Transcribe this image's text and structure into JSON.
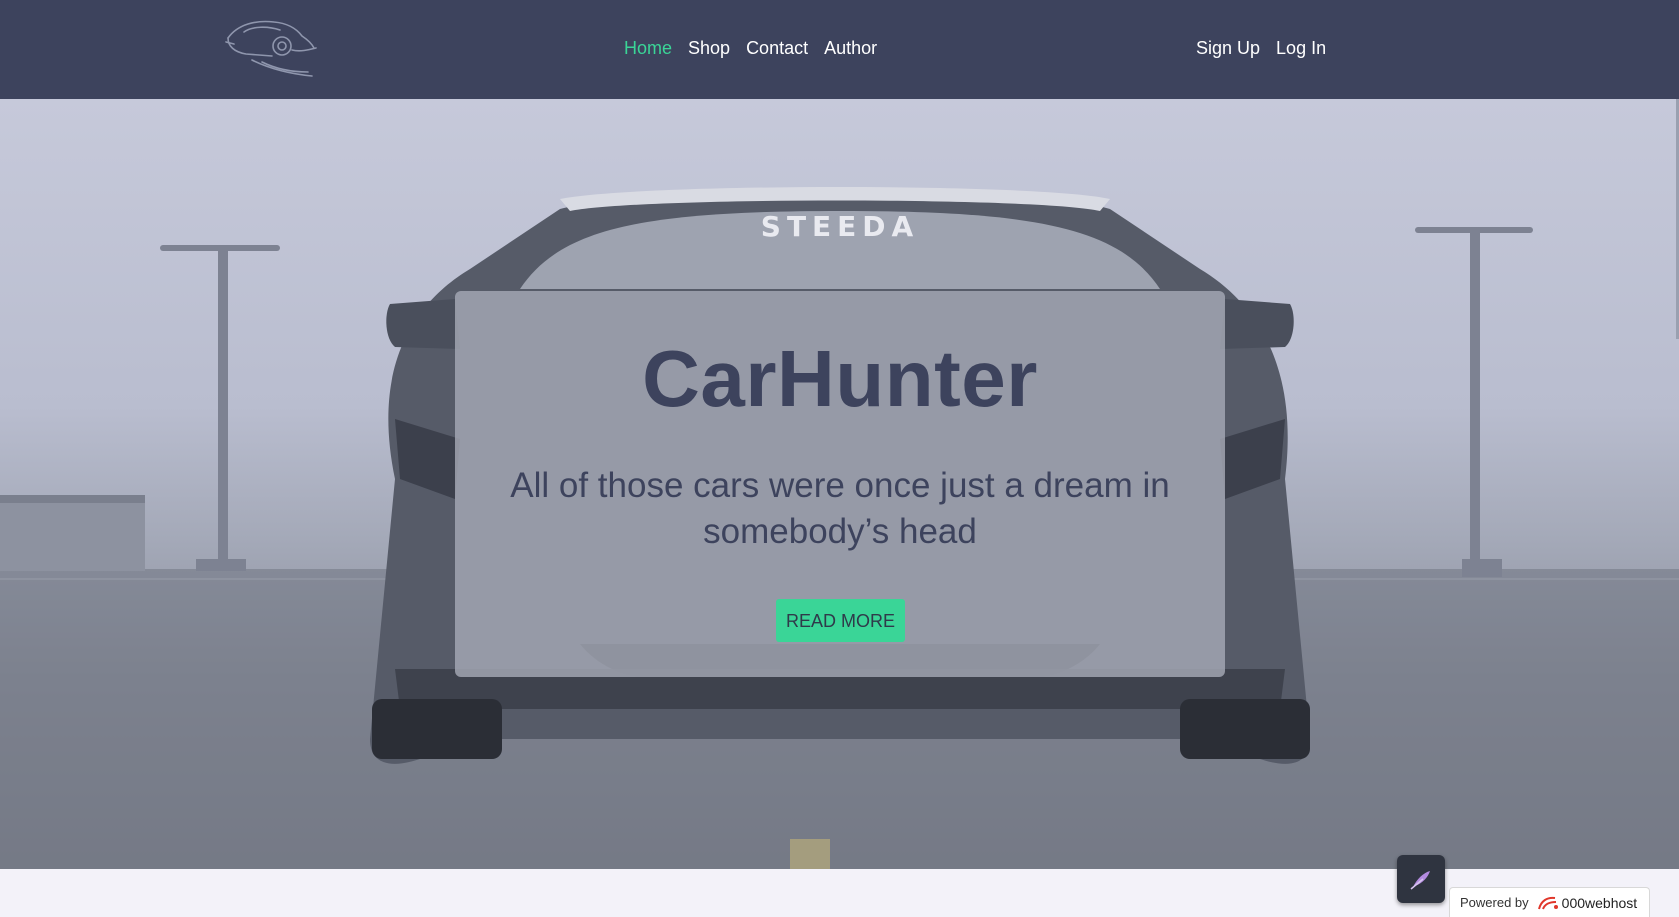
{
  "nav": {
    "logo_icon": "car-silhouette-logo",
    "links": [
      {
        "label": "Home",
        "active": true
      },
      {
        "label": "Shop",
        "active": false
      },
      {
        "label": "Contact",
        "active": false
      },
      {
        "label": "Author",
        "active": false
      }
    ],
    "auth": {
      "signup_label": "Sign Up",
      "login_label": "Log In"
    }
  },
  "hero": {
    "windshield_text": "STEEDA",
    "title": "CarHunter",
    "subtitle": "All of those cars were once just a dream in somebody’s head",
    "cta_label": "READ MORE"
  },
  "widget": {
    "fab_icon": "feather-icon"
  },
  "footer_badge": {
    "prefix": "Powered by",
    "brand": "000webhost",
    "brand_icon": "000webhost-logo-icon"
  },
  "colors": {
    "navbar_bg": "#3d435d",
    "accent": "#3ad597",
    "text_dark": "#3d435d",
    "page_bg": "#f3f2f9"
  }
}
